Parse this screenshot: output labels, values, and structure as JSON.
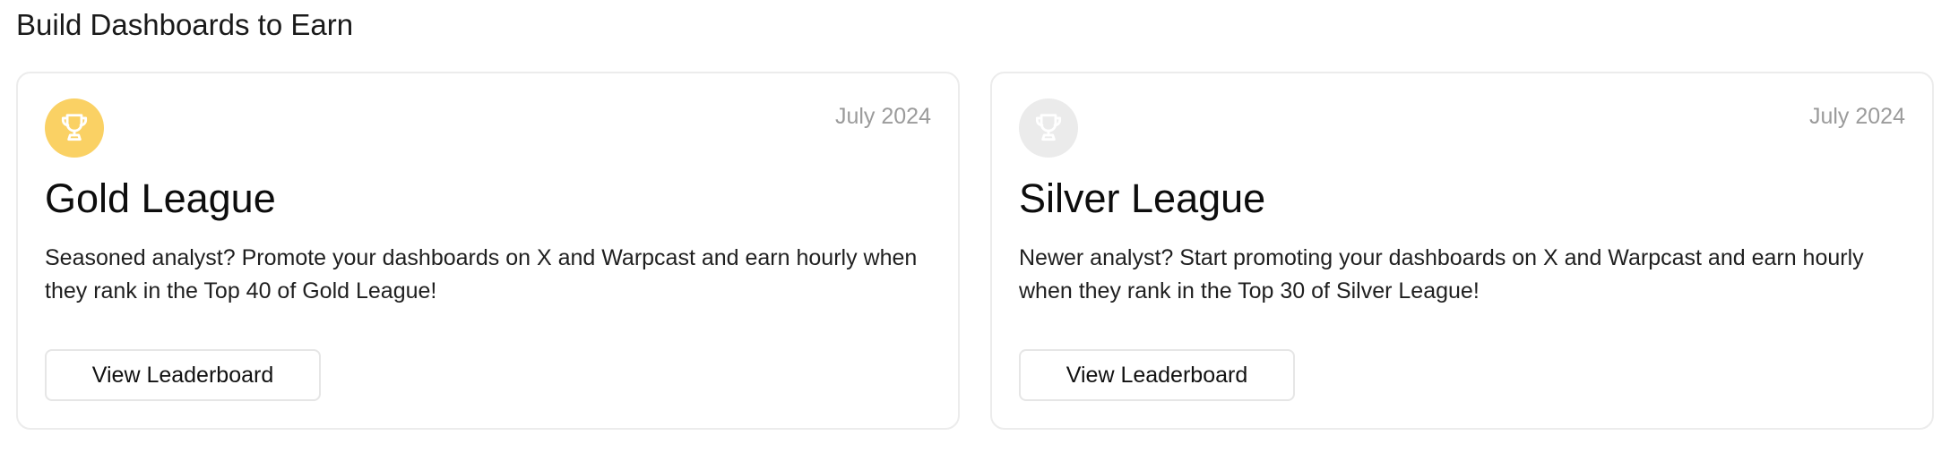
{
  "section": {
    "title": "Build Dashboards to Earn"
  },
  "cards": [
    {
      "date": "July 2024",
      "title": "Gold League",
      "description": "Seasoned analyst? Promote your dashboards on X and Warpcast and earn hourly when they rank in the Top 40 of Gold League!",
      "button_label": "View Leaderboard",
      "icon": "trophy-icon",
      "icon_bg_color": "#fad164",
      "icon_fg_color": "#ffffff"
    },
    {
      "date": "July 2024",
      "title": "Silver League",
      "description": "Newer analyst? Start promoting your dashboards on X and Warpcast and earn hourly when they rank in the Top 30 of Silver League!",
      "button_label": "View Leaderboard",
      "icon": "trophy-icon",
      "icon_bg_color": "#ebebeb",
      "icon_fg_color": "#ffffff"
    }
  ]
}
